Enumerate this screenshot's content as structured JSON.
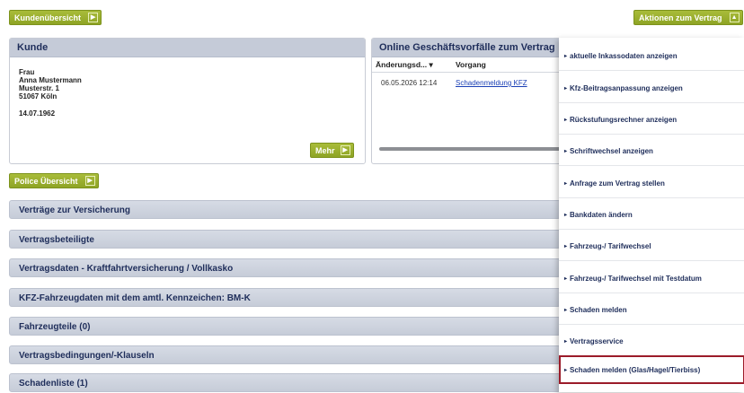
{
  "top": {
    "kundenuebersicht_label": "Kundenübersicht",
    "aktionen_label": "Aktionen zum Vertrag",
    "aktionen_arrow": "▲",
    "arrow": "▶"
  },
  "kunde": {
    "title": "Kunde",
    "salutation": "Frau",
    "name": "Anna Mustermann",
    "street": "Musterstr. 1",
    "city": "51067 Köln",
    "birthdate": "14.07.1962",
    "mehr_label": "Mehr"
  },
  "online": {
    "title": "Online Geschäftsvorfälle zum Vertrag",
    "col_date": "Änderungsd...",
    "col_sort": "▾",
    "col_vorgang": "Vorgang",
    "row_date": "06.05.2026 12:14",
    "row_link": "Schadenmeldung KFZ"
  },
  "police": {
    "label": "Police Übersicht"
  },
  "sections": [
    "Verträge zur Versicherung",
    "Vertragsbeteiligte",
    "Vertragsdaten - Kraftfahrtversicherung / Vollkasko",
    "KFZ-Fahrzeugdaten mit dem amtl. Kennzeichen: BM-K",
    "Fahrzeugteile (0)",
    "Vertragsbedingungen/-Klauseln",
    "Schadenliste (1)"
  ],
  "menu": [
    "aktuelle Inkassodaten anzeigen",
    "Kfz-Beitragsanpassung anzeigen",
    "Rückstufungsrechner anzeigen",
    "Schriftwechsel anzeigen",
    "Anfrage zum Vertrag stellen",
    "Bankdaten ändern",
    "Fahrzeug-/ Tarifwechsel",
    "Fahrzeug-/ Tarifwechsel mit Testdatum",
    "Schaden melden",
    "Vertragsservice",
    "Schaden melden (Glas/Hagel/Tierbiss)"
  ],
  "menu_bullet": "▸",
  "colors": {
    "accent_green": "#8ea425",
    "header_blue": "#c5cbd8",
    "highlight_red": "#9b1b29"
  }
}
